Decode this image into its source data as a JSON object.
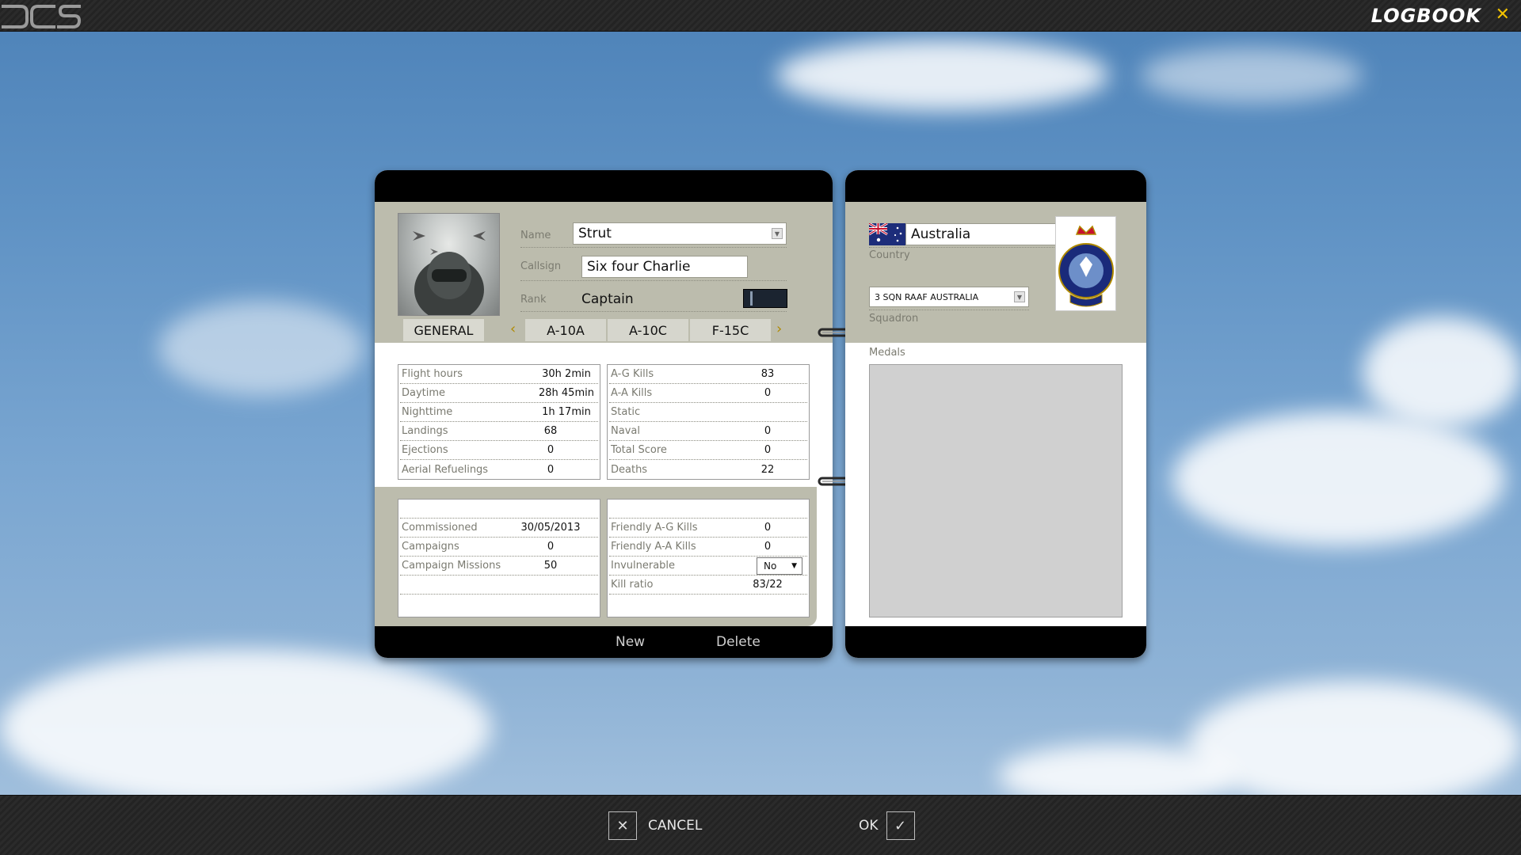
{
  "app": {
    "title": "LOGBOOK"
  },
  "pilot": {
    "name_label": "Name",
    "name": "Strut",
    "callsign_label": "Callsign",
    "callsign": "Six four Charlie",
    "rank_label": "Rank",
    "rank": "Captain"
  },
  "tabs": [
    "GENERAL",
    "A-10A",
    "A-10C",
    "F-15C"
  ],
  "stats_left": [
    {
      "label": "Flight hours",
      "value": "30h 2min"
    },
    {
      "label": "Daytime",
      "value": "28h 45min"
    },
    {
      "label": "Nighttime",
      "value": "1h 17min"
    },
    {
      "label": "Landings",
      "value": "68"
    },
    {
      "label": "Ejections",
      "value": "0"
    },
    {
      "label": "Aerial Refuelings",
      "value": "0"
    }
  ],
  "stats_right": [
    {
      "label": "A-G Kills",
      "value": "83"
    },
    {
      "label": "A-A Kills",
      "value": "0"
    },
    {
      "label": "Static",
      "value": ""
    },
    {
      "label": "Naval",
      "value": "0"
    },
    {
      "label": "Total Score",
      "value": "0"
    },
    {
      "label": "Deaths",
      "value": "22"
    }
  ],
  "career_left": [
    {
      "label": "Commissioned",
      "value": "30/05/2013"
    },
    {
      "label": "Campaigns",
      "value": "0"
    },
    {
      "label": "Campaign Missions",
      "value": "50"
    }
  ],
  "career_right": [
    {
      "label": "Friendly A-G Kills",
      "value": "0"
    },
    {
      "label": "Friendly A-A Kills",
      "value": "0"
    },
    {
      "label": "Invulnerable",
      "value": "No"
    },
    {
      "label": "Kill ratio",
      "value": "83/22"
    }
  ],
  "footer": {
    "new_label": "New",
    "delete_label": "Delete"
  },
  "profile": {
    "country": "Australia",
    "country_label": "Country",
    "squadron": "3 SQN RAAF AUSTRALIA",
    "squadron_label": "Squadron",
    "medals_label": "Medals"
  },
  "dialog": {
    "cancel_label": "CANCEL",
    "ok_label": "OK"
  },
  "icons": {
    "close": "close-icon",
    "cancel": "x-icon",
    "ok": "check-icon",
    "dropdown": "chevron-down-icon"
  },
  "colors": {
    "accent": "#f2c200",
    "panel": "#bcbcad"
  }
}
